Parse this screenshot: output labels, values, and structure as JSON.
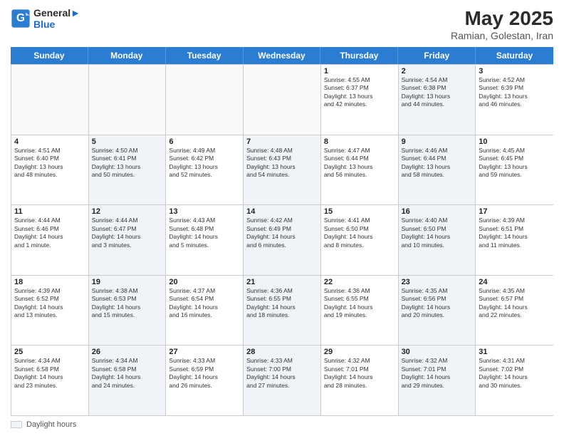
{
  "header": {
    "logo_line1": "General",
    "logo_line2": "Blue",
    "month_title": "May 2025",
    "location": "Ramian, Golestan, Iran"
  },
  "days_of_week": [
    "Sunday",
    "Monday",
    "Tuesday",
    "Wednesday",
    "Thursday",
    "Friday",
    "Saturday"
  ],
  "footer": {
    "legend_label": "Daylight hours"
  },
  "weeks": [
    [
      {
        "day": "",
        "info": "",
        "empty": true
      },
      {
        "day": "",
        "info": "",
        "empty": true
      },
      {
        "day": "",
        "info": "",
        "empty": true
      },
      {
        "day": "",
        "info": "",
        "empty": true
      },
      {
        "day": "1",
        "info": "Sunrise: 4:55 AM\nSunset: 6:37 PM\nDaylight: 13 hours\nand 42 minutes.",
        "alt": false
      },
      {
        "day": "2",
        "info": "Sunrise: 4:54 AM\nSunset: 6:38 PM\nDaylight: 13 hours\nand 44 minutes.",
        "alt": true
      },
      {
        "day": "3",
        "info": "Sunrise: 4:52 AM\nSunset: 6:39 PM\nDaylight: 13 hours\nand 46 minutes.",
        "alt": false
      }
    ],
    [
      {
        "day": "4",
        "info": "Sunrise: 4:51 AM\nSunset: 6:40 PM\nDaylight: 13 hours\nand 48 minutes.",
        "alt": false
      },
      {
        "day": "5",
        "info": "Sunrise: 4:50 AM\nSunset: 6:41 PM\nDaylight: 13 hours\nand 50 minutes.",
        "alt": true
      },
      {
        "day": "6",
        "info": "Sunrise: 4:49 AM\nSunset: 6:42 PM\nDaylight: 13 hours\nand 52 minutes.",
        "alt": false
      },
      {
        "day": "7",
        "info": "Sunrise: 4:48 AM\nSunset: 6:43 PM\nDaylight: 13 hours\nand 54 minutes.",
        "alt": true
      },
      {
        "day": "8",
        "info": "Sunrise: 4:47 AM\nSunset: 6:44 PM\nDaylight: 13 hours\nand 56 minutes.",
        "alt": false
      },
      {
        "day": "9",
        "info": "Sunrise: 4:46 AM\nSunset: 6:44 PM\nDaylight: 13 hours\nand 58 minutes.",
        "alt": true
      },
      {
        "day": "10",
        "info": "Sunrise: 4:45 AM\nSunset: 6:45 PM\nDaylight: 13 hours\nand 59 minutes.",
        "alt": false
      }
    ],
    [
      {
        "day": "11",
        "info": "Sunrise: 4:44 AM\nSunset: 6:46 PM\nDaylight: 14 hours\nand 1 minute.",
        "alt": false
      },
      {
        "day": "12",
        "info": "Sunrise: 4:44 AM\nSunset: 6:47 PM\nDaylight: 14 hours\nand 3 minutes.",
        "alt": true
      },
      {
        "day": "13",
        "info": "Sunrise: 4:43 AM\nSunset: 6:48 PM\nDaylight: 14 hours\nand 5 minutes.",
        "alt": false
      },
      {
        "day": "14",
        "info": "Sunrise: 4:42 AM\nSunset: 6:49 PM\nDaylight: 14 hours\nand 6 minutes.",
        "alt": true
      },
      {
        "day": "15",
        "info": "Sunrise: 4:41 AM\nSunset: 6:50 PM\nDaylight: 14 hours\nand 8 minutes.",
        "alt": false
      },
      {
        "day": "16",
        "info": "Sunrise: 4:40 AM\nSunset: 6:50 PM\nDaylight: 14 hours\nand 10 minutes.",
        "alt": true
      },
      {
        "day": "17",
        "info": "Sunrise: 4:39 AM\nSunset: 6:51 PM\nDaylight: 14 hours\nand 11 minutes.",
        "alt": false
      }
    ],
    [
      {
        "day": "18",
        "info": "Sunrise: 4:39 AM\nSunset: 6:52 PM\nDaylight: 14 hours\nand 13 minutes.",
        "alt": false
      },
      {
        "day": "19",
        "info": "Sunrise: 4:38 AM\nSunset: 6:53 PM\nDaylight: 14 hours\nand 15 minutes.",
        "alt": true
      },
      {
        "day": "20",
        "info": "Sunrise: 4:37 AM\nSunset: 6:54 PM\nDaylight: 14 hours\nand 16 minutes.",
        "alt": false
      },
      {
        "day": "21",
        "info": "Sunrise: 4:36 AM\nSunset: 6:55 PM\nDaylight: 14 hours\nand 18 minutes.",
        "alt": true
      },
      {
        "day": "22",
        "info": "Sunrise: 4:36 AM\nSunset: 6:55 PM\nDaylight: 14 hours\nand 19 minutes.",
        "alt": false
      },
      {
        "day": "23",
        "info": "Sunrise: 4:35 AM\nSunset: 6:56 PM\nDaylight: 14 hours\nand 20 minutes.",
        "alt": true
      },
      {
        "day": "24",
        "info": "Sunrise: 4:35 AM\nSunset: 6:57 PM\nDaylight: 14 hours\nand 22 minutes.",
        "alt": false
      }
    ],
    [
      {
        "day": "25",
        "info": "Sunrise: 4:34 AM\nSunset: 6:58 PM\nDaylight: 14 hours\nand 23 minutes.",
        "alt": false
      },
      {
        "day": "26",
        "info": "Sunrise: 4:34 AM\nSunset: 6:58 PM\nDaylight: 14 hours\nand 24 minutes.",
        "alt": true
      },
      {
        "day": "27",
        "info": "Sunrise: 4:33 AM\nSunset: 6:59 PM\nDaylight: 14 hours\nand 26 minutes.",
        "alt": false
      },
      {
        "day": "28",
        "info": "Sunrise: 4:33 AM\nSunset: 7:00 PM\nDaylight: 14 hours\nand 27 minutes.",
        "alt": true
      },
      {
        "day": "29",
        "info": "Sunrise: 4:32 AM\nSunset: 7:01 PM\nDaylight: 14 hours\nand 28 minutes.",
        "alt": false
      },
      {
        "day": "30",
        "info": "Sunrise: 4:32 AM\nSunset: 7:01 PM\nDaylight: 14 hours\nand 29 minutes.",
        "alt": true
      },
      {
        "day": "31",
        "info": "Sunrise: 4:31 AM\nSunset: 7:02 PM\nDaylight: 14 hours\nand 30 minutes.",
        "alt": false
      }
    ]
  ]
}
